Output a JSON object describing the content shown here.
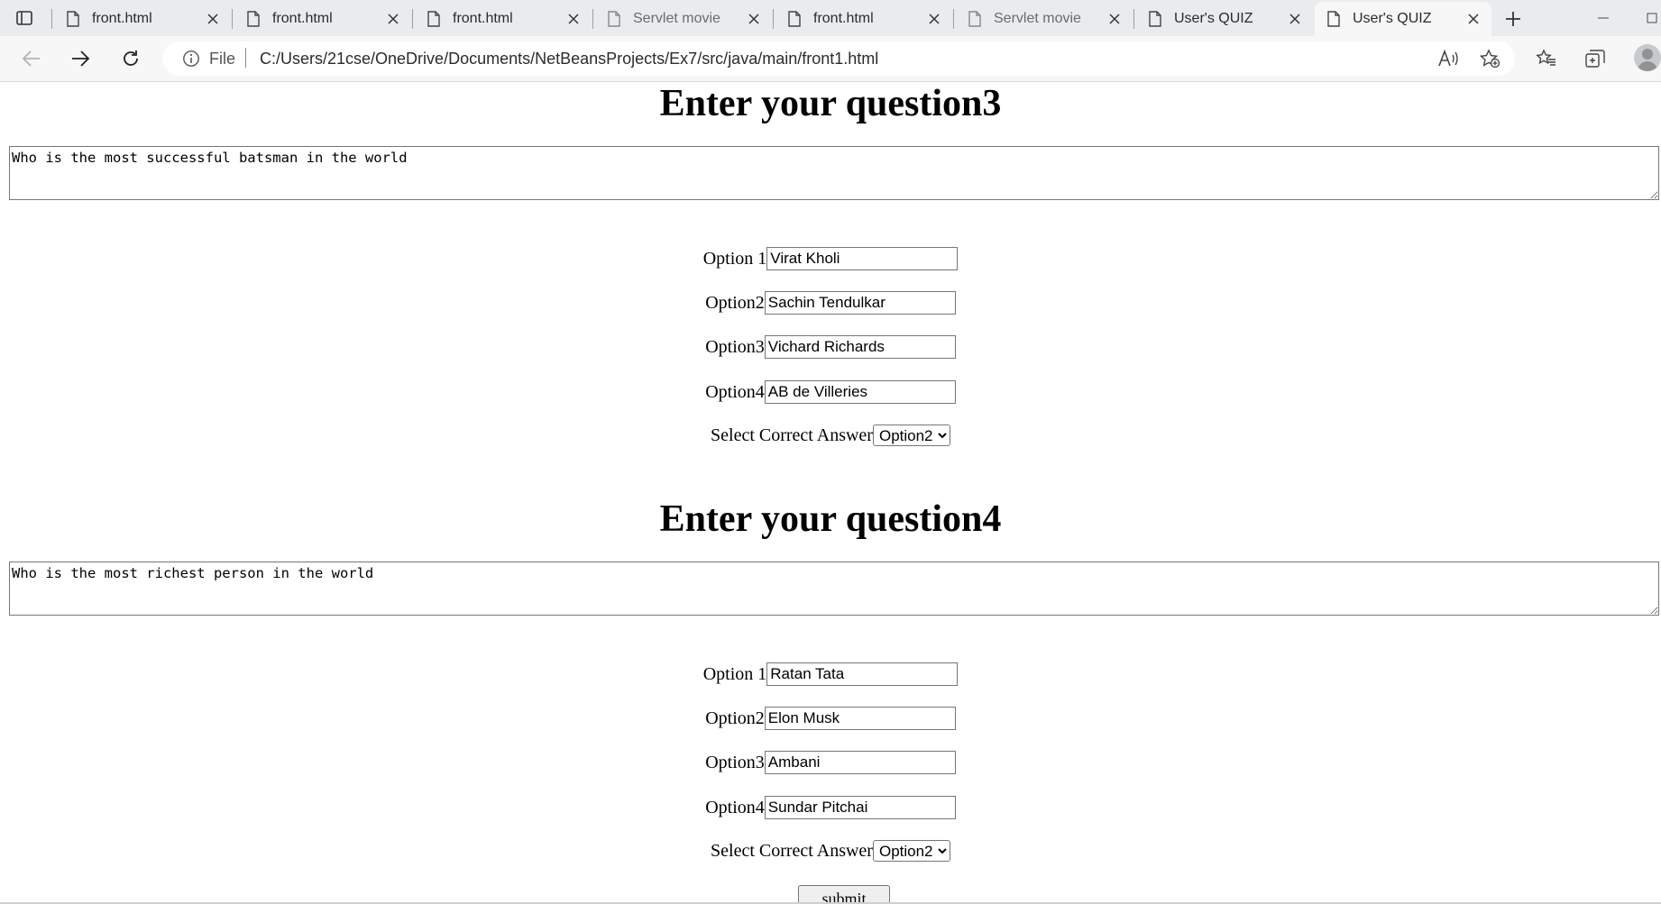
{
  "browser": {
    "tabs": [
      {
        "label": "front.html",
        "state": "normal"
      },
      {
        "label": "front.html",
        "state": "normal"
      },
      {
        "label": "front.html",
        "state": "normal"
      },
      {
        "label": "Servlet movie",
        "state": "dim"
      },
      {
        "label": "front.html",
        "state": "normal"
      },
      {
        "label": "Servlet movie",
        "state": "dim"
      },
      {
        "label": "User's QUIZ",
        "state": "normal"
      },
      {
        "label": "User's QUIZ",
        "state": "active"
      }
    ],
    "address": {
      "scheme_label": "File",
      "url": "C:/Users/21cse/OneDrive/Documents/NetBeansProjects/Ex7/src/java/main/front1.html"
    },
    "icons": [
      "tab-actions-icon",
      "document-icon",
      "close-icon",
      "plus-icon",
      "minimize-icon",
      "maximize-icon",
      "back-arrow-icon",
      "forward-arrow-icon",
      "refresh-icon",
      "info-icon",
      "read-aloud-icon",
      "add-favorite-icon",
      "favorites-icon",
      "collections-icon",
      "profile-avatar"
    ]
  },
  "questions": [
    {
      "title": "Enter your question3",
      "text": "Who is the most successful batsman in the world",
      "options": [
        {
          "label": "Option 1",
          "value": "Virat Kholi"
        },
        {
          "label": "Option2",
          "value": "Sachin Tendulkar"
        },
        {
          "label": "Option3",
          "value": "Vichard Richards"
        },
        {
          "label": "Option4",
          "value": "AB de Villeries"
        }
      ],
      "answer_label": "Select Correct Answer",
      "answer_value": "Option2"
    },
    {
      "title": "Enter your question4",
      "text": "Who is the most richest person in the world",
      "options": [
        {
          "label": "Option 1",
          "value": "Ratan Tata"
        },
        {
          "label": "Option2",
          "value": "Elon Musk"
        },
        {
          "label": "Option3",
          "value": "Ambani"
        },
        {
          "label": "Option4",
          "value": "Sundar Pitchai"
        }
      ],
      "answer_label": "Select Correct Answer",
      "answer_value": "Option2"
    }
  ],
  "submit_label": "submit"
}
